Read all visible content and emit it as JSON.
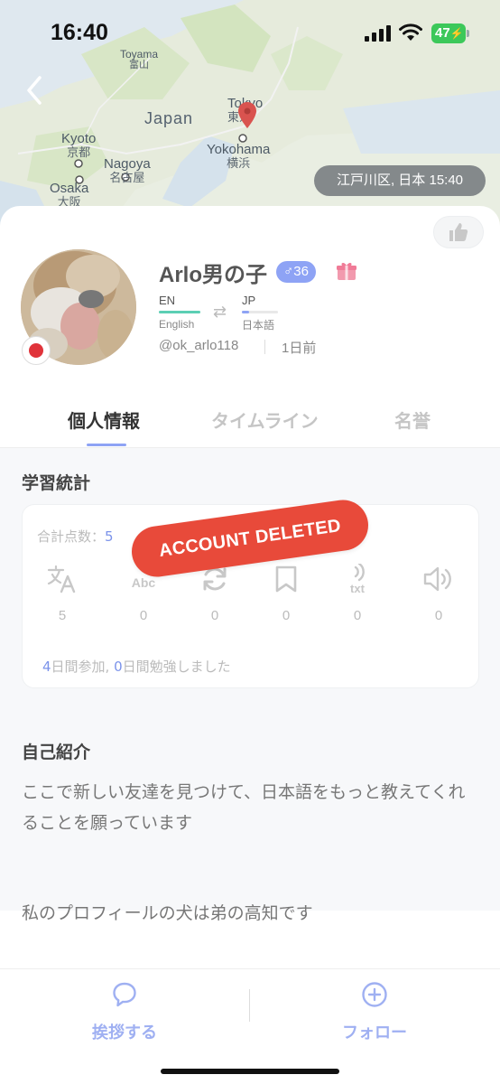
{
  "status_bar": {
    "time": "16:40",
    "battery": "47"
  },
  "map": {
    "labels": {
      "tokyo": {
        "en": "Tokyo",
        "jp": "東京"
      },
      "yokohama": {
        "en": "Yokohama",
        "jp": "横浜"
      },
      "japan": "Japan",
      "kyoto": {
        "en": "Kyoto",
        "jp": "京都"
      },
      "nagoya": {
        "en": "Nagoya",
        "jp": "名古屋"
      },
      "osaka": {
        "en": "Osaka",
        "jp": "大阪"
      },
      "toyama": {
        "en": "Toyama",
        "jp": "富山"
      }
    },
    "location_badge": "江戸川区, 日本 15:40"
  },
  "profile": {
    "name": "Arlo男の子",
    "gender_symbol": "♂",
    "age": "36",
    "native": {
      "code": "EN",
      "name": "English",
      "color": "#5ccfb4",
      "level": 1.0
    },
    "learning": {
      "code": "JP",
      "name": "日本語",
      "color": "#8ea3f5",
      "level": 0.2
    },
    "handle": "@ok_arlo118",
    "last_seen": "1日前"
  },
  "tabs": [
    {
      "label": "個人情報",
      "active": true
    },
    {
      "label": "タイムライン",
      "active": false
    },
    {
      "label": "名誉",
      "active": false
    }
  ],
  "stats": {
    "title": "学習統計",
    "total_label": "合計点数：",
    "total_value": "5",
    "items": [
      {
        "icon": "translate-icon",
        "value": "5"
      },
      {
        "icon": "spellcheck-icon",
        "value": "0"
      },
      {
        "icon": "refresh-icon",
        "value": "0"
      },
      {
        "icon": "bookmark-icon",
        "value": "0"
      },
      {
        "icon": "text-to-speech-icon",
        "value": "0"
      },
      {
        "icon": "speaker-icon",
        "value": "0"
      }
    ],
    "days_joined": "4",
    "days_joined_label": "日間参加, ",
    "days_studied": "0",
    "days_studied_label": "日間勉強しました"
  },
  "stamp": "ACCOUNT DELETED",
  "intro": {
    "title": "自己紹介",
    "text1": "ここで新しい友達を見つけて、日本語をもっと教えてくれることを願っています",
    "text2": "私のプロフィールの犬は弟の高知です"
  },
  "bottom_bar": {
    "greet_label": "挨拶する",
    "follow_label": "フォロー"
  },
  "colors": {
    "accent": "#8ea3f5",
    "stamp": "#e84a3a",
    "pin": "#d9534f"
  }
}
